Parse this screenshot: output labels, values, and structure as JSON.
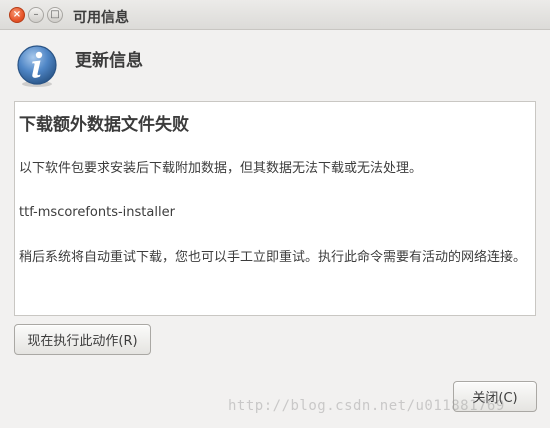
{
  "window": {
    "title": "可用信息",
    "close_glyph": "×",
    "minimize_glyph": "–",
    "maximize_glyph": "□"
  },
  "header": {
    "icon": "info-icon",
    "title": "更新信息"
  },
  "message": {
    "title": "下载额外数据文件失败",
    "line1": "以下软件包要求安装后下载附加数据，但其数据无法下载或无法处理。",
    "package": "ttf-mscorefonts-installer",
    "line3": "稍后系统将自动重试下载，您也可以手工立即重试。执行此命令需要有活动的网络连接。"
  },
  "buttons": {
    "run_now": "现在执行此动作(R)",
    "close": "关闭(C)"
  },
  "watermark": "http://blog.csdn.net/u011881769",
  "colors": {
    "background": "#f2f1f0",
    "close_button": "#e8552a",
    "info_icon": "#3a6ea5"
  }
}
